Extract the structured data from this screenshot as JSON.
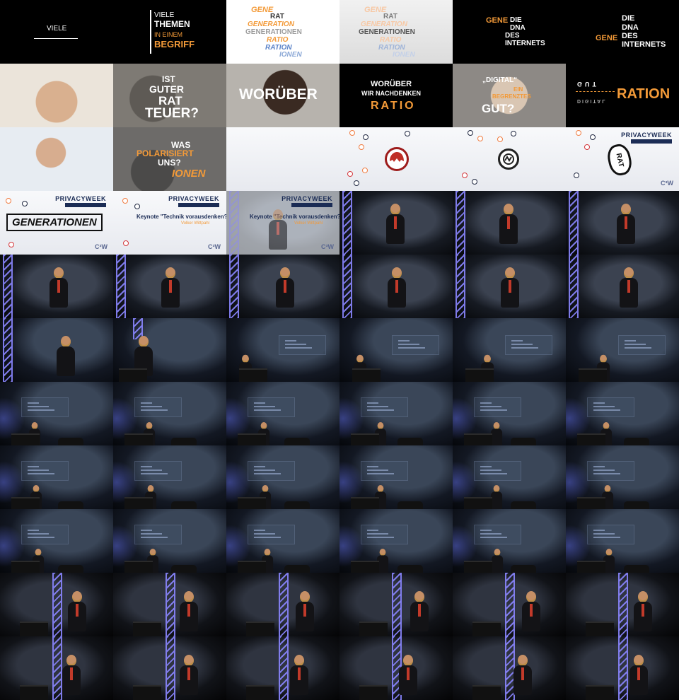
{
  "contact_sheet": {
    "frame_texts": {
      "f1": {
        "viele": "VIELE"
      },
      "f2": {
        "viele": "VIELE",
        "themen": "THEMEN",
        "in_einem": "IN EINEM",
        "begriff": "BEGRIFF"
      },
      "f3": {
        "gene": "GENE",
        "rat": "RAT",
        "generation": "GENERATION",
        "generationen": "GENERATIONEN",
        "ratio": "RATIO",
        "ration": "RATION",
        "ionen": "IONEN"
      },
      "f4": {
        "gene": "GENE",
        "rat": "RAT",
        "generation": "GENERATION",
        "generationen": "GENERATIONEN",
        "ratio": "RATIO",
        "ration": "RATION",
        "ionen": "IONEN"
      },
      "f5": {
        "gene": "GENE",
        "die": "DIE",
        "dna": "DNA",
        "des": "DES",
        "internets": "INTERNETS"
      },
      "f6": {
        "die": "DIE",
        "dna": "DNA",
        "gene": "GENE",
        "des": "DES",
        "internets": "INTERNETS"
      },
      "f8": {
        "ist": "IST",
        "guter": "GUTER",
        "rat": "RAT",
        "teuer": "TEUER?"
      },
      "f9": {
        "worueber": "WORÜBER"
      },
      "f10": {
        "worueber": "WORÜBER",
        "wir_nachdenken": "WIR NACHDENKEN",
        "ratio": "RATIO"
      },
      "f11": {
        "digital": "„DIGITAL“",
        "ein": "EIN",
        "begrenztes": "BEGRENZTES",
        "gut": "GUT?"
      },
      "f12": {
        "ration": "RATION",
        "gut_mirror": "GUT",
        "digital_mirror": "DIGITAL"
      },
      "f14": {
        "was": "WAS",
        "polarisiert": "POLARISIERT",
        "uns": "UNS?",
        "ionen": "IONEN"
      },
      "f18": {
        "privacyweek": "PRIVACYWEEK",
        "rat": "RAT",
        "cw": "C³W"
      },
      "f19": {
        "privacyweek": "PRIVACYWEEK",
        "generationen": "GENERATIONEN",
        "cw": "C³W"
      },
      "f20": {
        "privacyweek": "PRIVACYWEEK",
        "keynote": "Keynote \"Technik vorausdenken?\"",
        "speaker": "Volker Wittpahl",
        "cw": "C³W"
      },
      "f21": {
        "privacyweek": "PRIVACYWEEK",
        "keynote": "Keynote \"Technik vorausdenken?\"",
        "speaker": "Volker Wittpahl",
        "cw": "C³W"
      }
    },
    "colors": {
      "accent_orange": "#f39a38",
      "privacy_navy": "#1b2c55",
      "stage_blue": "#8a86ff"
    }
  }
}
